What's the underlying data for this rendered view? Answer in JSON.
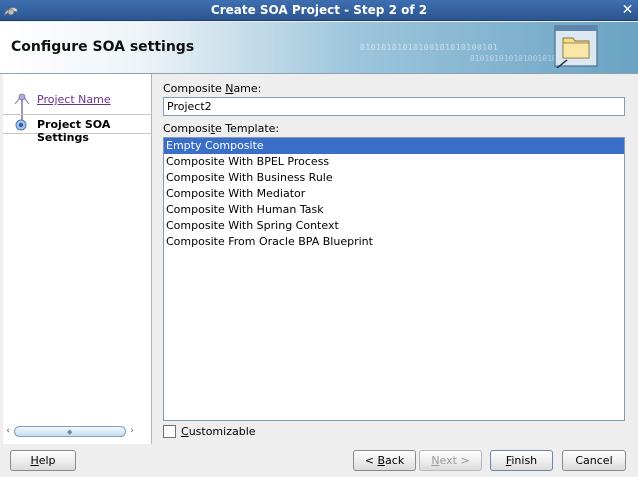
{
  "window": {
    "title": "Create SOA Project - Step 2 of 2",
    "close_glyph": "✕"
  },
  "header": {
    "title": "Configure SOA settings",
    "decor_binary": "01010101010100101010100101"
  },
  "nav": {
    "steps": [
      {
        "label": "Project Name",
        "state": "completed",
        "icon": "step-completed-icon"
      },
      {
        "label": "Project SOA Settings",
        "state": "current",
        "icon": "step-current-icon"
      }
    ]
  },
  "form": {
    "composite_name_label": "Composite Name:",
    "composite_name_value": "Project2",
    "composite_template_label": "Composite Template:",
    "templates": [
      "Empty Composite",
      "Composite With BPEL Process",
      "Composite With Business Rule",
      "Composite With Mediator",
      "Composite With Human Task",
      "Composite With Spring Context",
      "Composite From Oracle BPA Blueprint"
    ],
    "selected_template_index": 0,
    "customizable_label": "Customizable",
    "customizable_checked": false
  },
  "buttons": {
    "help": "Help",
    "back": "< Back",
    "next": "Next >",
    "finish": "Finish",
    "cancel": "Cancel"
  },
  "colors": {
    "title_bar": "#3f6fb0",
    "selection": "#3a6ec8",
    "visited_link": "#6b2f8f"
  }
}
